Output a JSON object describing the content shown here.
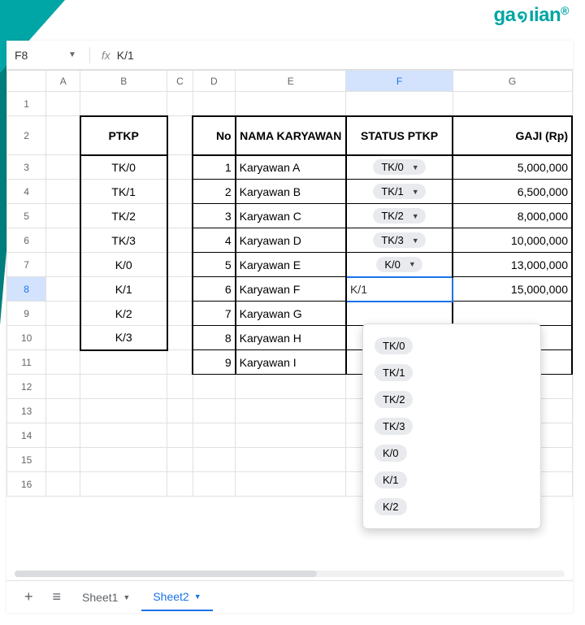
{
  "logo_text": "gaojian",
  "formula_bar": {
    "cell_ref": "F8",
    "fx": "fx",
    "value": "K/1"
  },
  "columns": [
    "",
    "A",
    "B",
    "C",
    "D",
    "E",
    "F",
    "G"
  ],
  "col_widths": [
    "46px",
    "40px",
    "102px",
    "30px",
    "50px",
    "130px",
    "125px",
    "140px"
  ],
  "selected_col": "F",
  "selected_row": "8",
  "rows_visible": 16,
  "headers": {
    "ptkp": "PTKP",
    "no": "No",
    "nama": "NAMA KARYAWAN",
    "status": "STATUS PTKP",
    "gaji": "GAJI (Rp)"
  },
  "ptkp_list": [
    "TK/0",
    "TK/1",
    "TK/2",
    "TK/3",
    "K/0",
    "K/1",
    "K/2",
    "K/3"
  ],
  "employees": [
    {
      "no": "1",
      "nama": "Karyawan A",
      "status": "TK/0",
      "gaji": "5,000,000"
    },
    {
      "no": "2",
      "nama": "Karyawan B",
      "status": "TK/1",
      "gaji": "6,500,000"
    },
    {
      "no": "3",
      "nama": "Karyawan C",
      "status": "TK/2",
      "gaji": "8,000,000"
    },
    {
      "no": "4",
      "nama": "Karyawan D",
      "status": "TK/3",
      "gaji": "10,000,000"
    },
    {
      "no": "5",
      "nama": "Karyawan E",
      "status": "K/0",
      "gaji": "13,000,000"
    },
    {
      "no": "6",
      "nama": "Karyawan F",
      "status": "K/1",
      "gaji": "15,000,000"
    },
    {
      "no": "7",
      "nama": "Karyawan G",
      "status": "",
      "gaji": ""
    },
    {
      "no": "8",
      "nama": "Karyawan H",
      "status": "",
      "gaji": ""
    },
    {
      "no": "9",
      "nama": "Karyawan I",
      "status": "",
      "gaji": ""
    }
  ],
  "active_cell_value": "K/1",
  "dropdown_options": [
    "TK/0",
    "TK/1",
    "TK/2",
    "TK/3",
    "K/0",
    "K/1",
    "K/2"
  ],
  "tabs": [
    {
      "name": "Sheet1",
      "active": false
    },
    {
      "name": "Sheet2",
      "active": true
    }
  ]
}
